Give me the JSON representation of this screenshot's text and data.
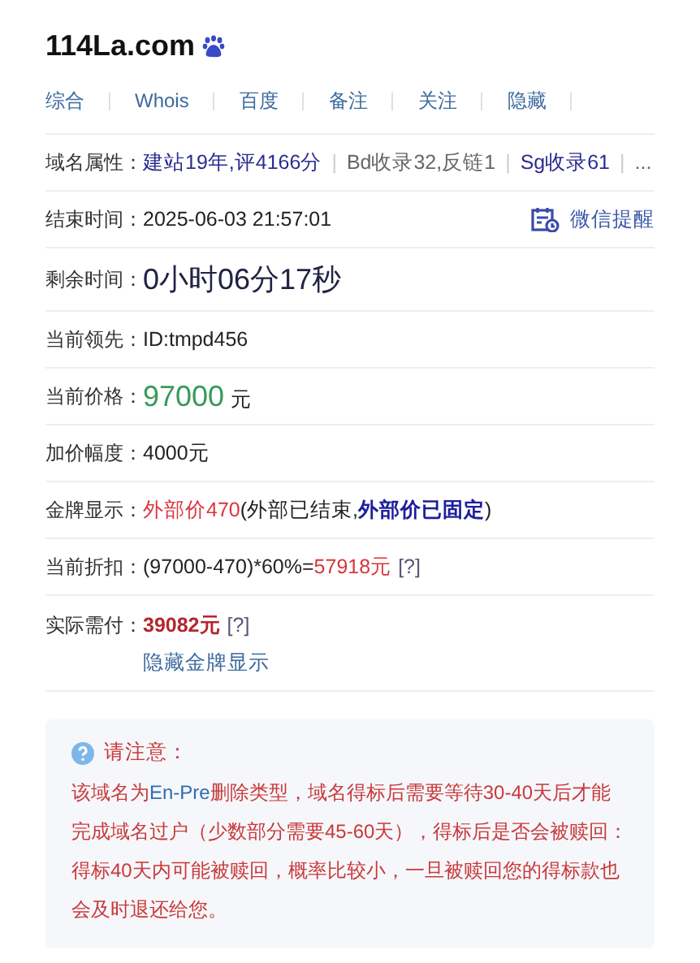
{
  "title": "114La.com",
  "tabs": [
    {
      "label": "综合"
    },
    {
      "label": "Whois"
    },
    {
      "label": "百度"
    },
    {
      "label": "备注"
    },
    {
      "label": "关注"
    },
    {
      "label": "隐藏"
    }
  ],
  "rows": [
    {
      "label": "域名属性：",
      "parts": [
        {
          "text": "建站19年,评4166分",
          "kind": "navy"
        },
        {
          "text": "|",
          "kind": "sep"
        },
        {
          "text": "Bd收录32,反链1",
          "kind": "muted"
        },
        {
          "text": "|",
          "kind": "sep"
        },
        {
          "text": "Sg收录61",
          "kind": "navy"
        },
        {
          "text": "|",
          "kind": "sep"
        },
        {
          "text": "...",
          "kind": "muted"
        }
      ]
    },
    {
      "label": "结束时间：",
      "parts": [
        {
          "text": "2025-06-03 21:57:01",
          "kind": "dark"
        }
      ],
      "action": "微信提醒"
    },
    {
      "label": "剩余时间：",
      "parts": [
        {
          "text": "0小时06分17秒",
          "kind": "countdown"
        }
      ]
    },
    {
      "label": "当前领先：",
      "parts": [
        {
          "text": "ID:tmpd456",
          "kind": "dark"
        }
      ]
    },
    {
      "label": "当前价格：",
      "parts": [
        {
          "text": "97000",
          "kind": "price"
        },
        {
          "text": "元",
          "kind": "dark"
        }
      ]
    },
    {
      "label": "加价幅度：",
      "parts": [
        {
          "text": "4000元",
          "kind": "dark"
        }
      ]
    },
    {
      "label": "金牌显示：",
      "parts": [
        {
          "text": "外部价470",
          "kind": "red"
        },
        {
          "text": "(外部已结束,",
          "kind": "dark"
        },
        {
          "text": "外部价已固定",
          "kind": "emphasis"
        },
        {
          "text": ")",
          "kind": "dark"
        }
      ]
    },
    {
      "label": "当前折扣：",
      "parts": [
        {
          "text": "(97000-470)*60%=",
          "kind": "dark"
        },
        {
          "text": "57918元",
          "kind": "red"
        },
        {
          "text": "[?]",
          "kind": "help"
        }
      ]
    },
    {
      "label": "实际需付：",
      "parts": [
        {
          "text": "39082元",
          "kind": "total"
        },
        {
          "text": "[?]",
          "kind": "help"
        }
      ],
      "link": "隐藏金牌显示"
    }
  ],
  "notice": {
    "heading": "请注意：",
    "body": [
      {
        "text": "该域名为",
        "kind": "plain"
      },
      {
        "text": "En-Pre",
        "kind": "highlight"
      },
      {
        "text": "删除类型，域名得标后需要等待30-40天后才能完成域名过户（少数部分需要45-60天），得标后是否会被赎回：得标40天内可能被赎回，概率比较小，一旦被赎回您的得标款也会及时退还给您。",
        "kind": "plain"
      }
    ]
  }
}
